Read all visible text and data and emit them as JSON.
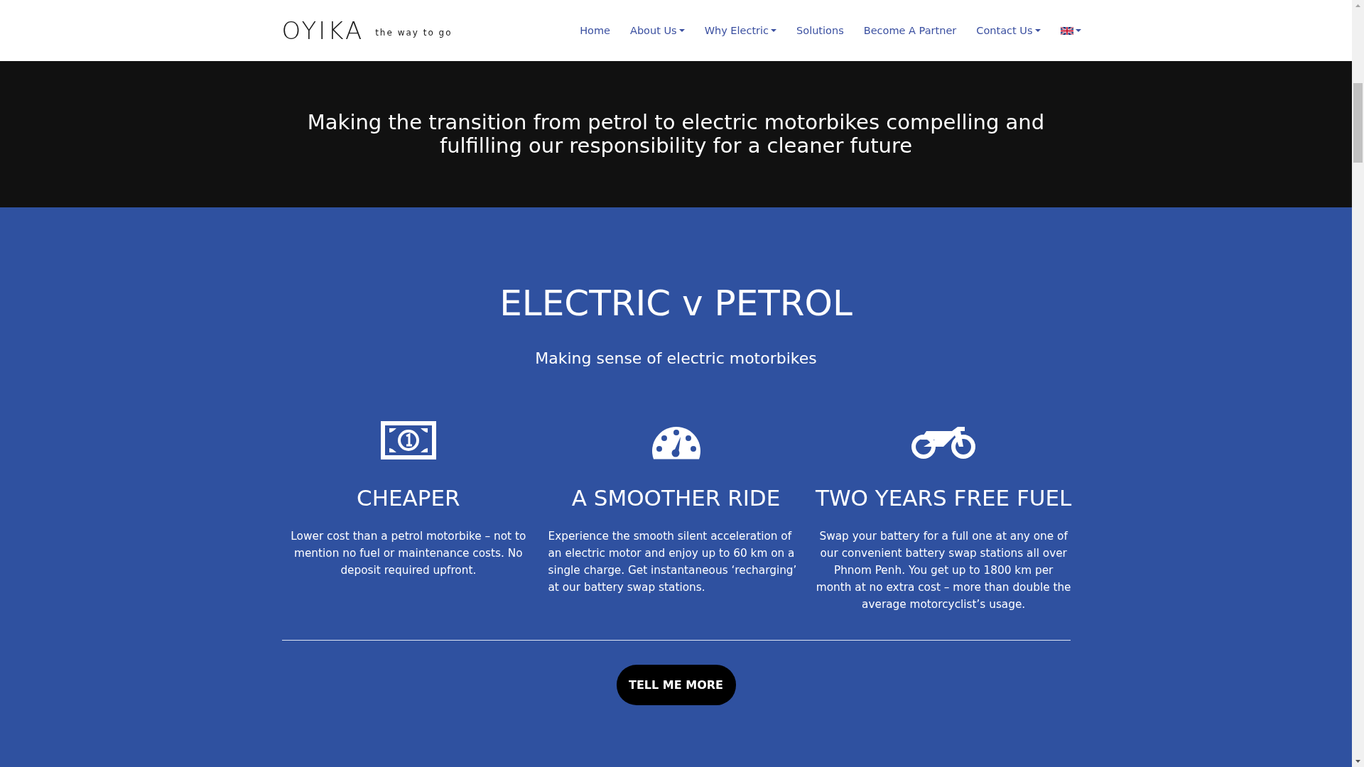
{
  "nav": {
    "logo": "OYIKA",
    "tagline": "the way to go",
    "items": [
      {
        "label": "Home",
        "dropdown": false
      },
      {
        "label": "About Us",
        "dropdown": true
      },
      {
        "label": "Why Electric",
        "dropdown": true
      },
      {
        "label": "Solutions",
        "dropdown": false
      },
      {
        "label": "Become A Partner",
        "dropdown": false
      },
      {
        "label": "Contact Us",
        "dropdown": true
      }
    ],
    "language_dropdown": true
  },
  "banner": {
    "text": "Making the transition from petrol to electric motorbikes compelling and fulfilling our responsibility for a cleaner future"
  },
  "section": {
    "title": "ELECTRIC v PETROL",
    "subtitle": "Making sense of electric motorbikes",
    "features": [
      {
        "kind": "money",
        "title": "CHEAPER",
        "text": "Lower cost than a petrol motorbike – not to mention no fuel or maintenance costs. No deposit required upfront."
      },
      {
        "kind": "gauge",
        "title": "A SMOOTHER RIDE",
        "text": "Experience the smooth silent acceleration of an electric motor and enjoy up to 60 km on a single charge. Get instantaneous ‘recharging’ at our battery swap stations.",
        "left_aligned": true
      },
      {
        "kind": "motorbike",
        "title": "TWO YEARS FREE FUEL",
        "text": "Swap your battery for a full one at any one of our convenient battery swap stations all over Phnom Penh. You get up to 1800 km per month at no extra cost – more than double the average motorcyclist’s usage."
      }
    ],
    "button": "TELL ME MORE"
  }
}
